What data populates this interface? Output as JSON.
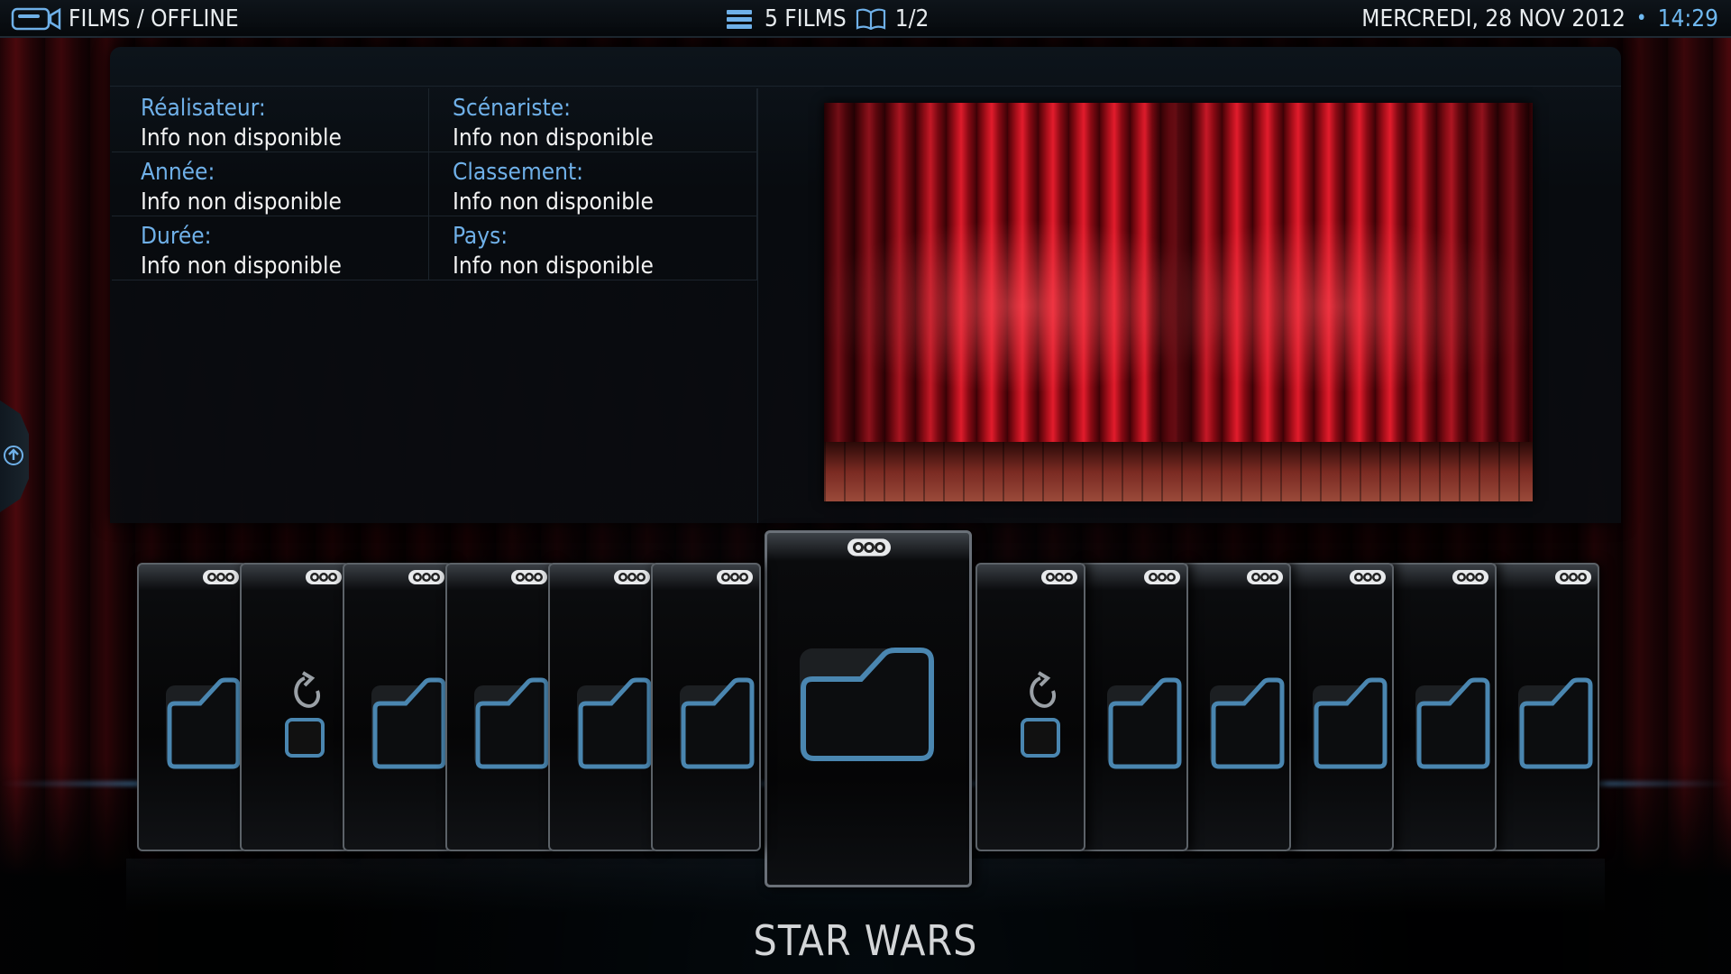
{
  "topbar": {
    "breadcrumb": "FILMS / OFFLINE",
    "count": "5 FILMS",
    "page": "1/2",
    "date": "MERCREDI, 28 NOV 2012",
    "separator": "•",
    "time": "14:29",
    "icons": [
      "camera-icon",
      "list-icon",
      "book-icon"
    ]
  },
  "details": [
    [
      {
        "label": "Réalisateur:",
        "value": "Info non disponible"
      },
      {
        "label": "Scénariste:",
        "value": "Info non disponible"
      }
    ],
    [
      {
        "label": "Année:",
        "value": "Info non disponible"
      },
      {
        "label": "Classement:",
        "value": "Info non disponible"
      }
    ],
    [
      {
        "label": "Durée:",
        "value": "Info non disponible"
      },
      {
        "label": "Pays:",
        "value": "Info non disponible"
      }
    ]
  ],
  "carousel": {
    "items": [
      "folder",
      "parent-folder",
      "folder",
      "folder",
      "folder",
      "folder",
      "folder",
      "parent-folder",
      "folder",
      "folder",
      "folder",
      "folder",
      "folder"
    ],
    "selected_index": 6,
    "selected_title": "STAR WARS"
  },
  "colors": {
    "accent": "#6fb0e8",
    "folder_outline": "#4a86b0",
    "curtain": "#b0101c"
  }
}
